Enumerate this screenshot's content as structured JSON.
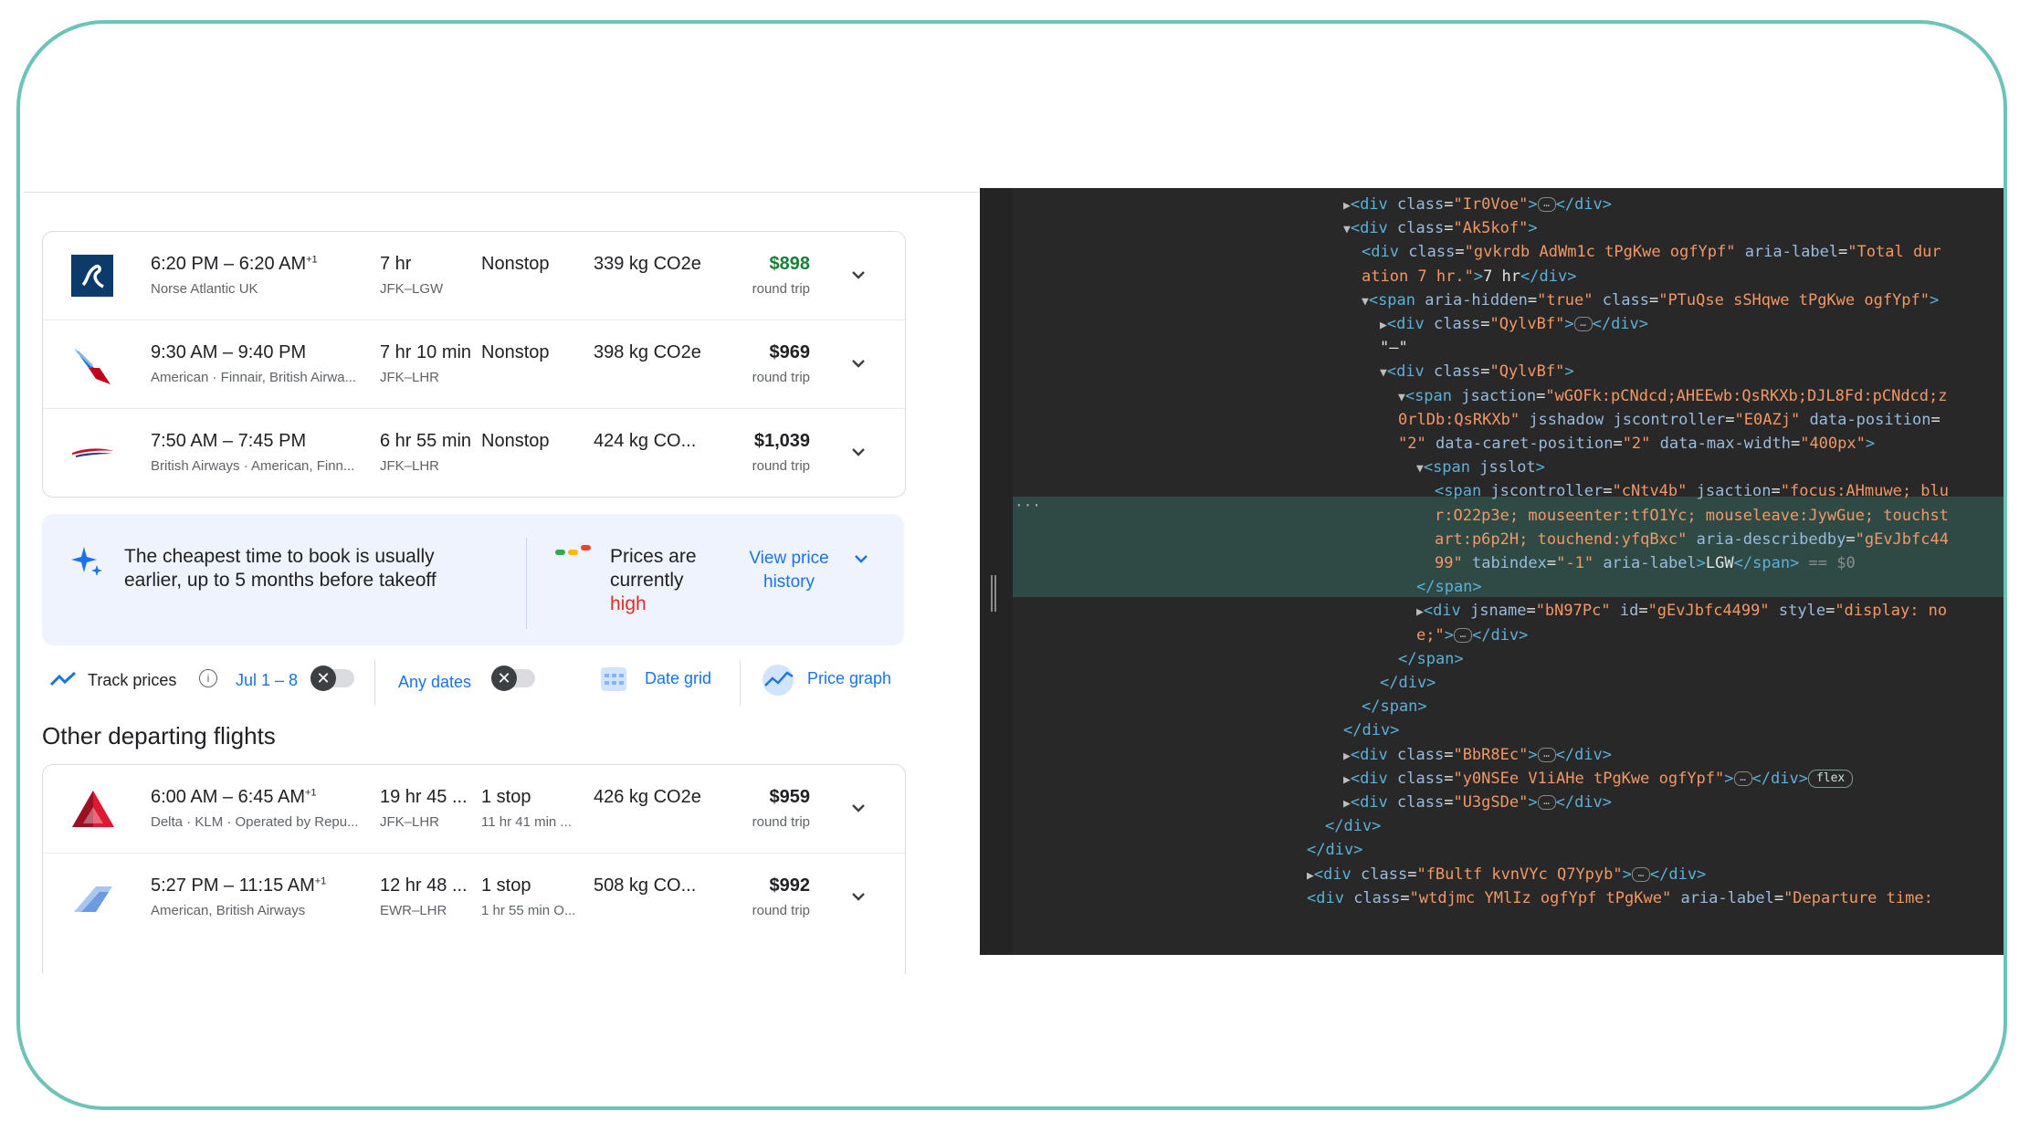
{
  "flights_top": [
    {
      "times": "6:20 PM – 6:20 AM",
      "plus": "+1",
      "airline": "Norse Atlantic UK",
      "duration": "7 hr",
      "route": "JFK–LGW",
      "stops": "Nonstop",
      "stops_sub": "",
      "co2": "339 kg CO2e",
      "price": "$898",
      "price_sub": "round trip",
      "price_color": "#188038",
      "logo": "norse-logo"
    },
    {
      "times": "9:30 AM – 9:40 PM",
      "plus": "",
      "airline": "American · Finnair, British Airwa...",
      "duration": "7 hr 10 min",
      "route": "JFK–LHR",
      "stops": "Nonstop",
      "stops_sub": "",
      "co2": "398 kg CO2e",
      "price": "$969",
      "price_sub": "round trip",
      "price_color": "#202124",
      "logo": "american-logo"
    },
    {
      "times": "7:50 AM – 7:45 PM",
      "plus": "",
      "airline": "British Airways · American, Finn...",
      "duration": "6 hr 55 min",
      "route": "JFK–LHR",
      "stops": "Nonstop",
      "stops_sub": "",
      "co2": "424 kg CO...",
      "price": "$1,039",
      "price_sub": "round trip",
      "price_color": "#202124",
      "logo": "british-airways-logo"
    }
  ],
  "tip": {
    "text": "The cheapest time to book is usually earlier, up to 5 months before takeoff",
    "prices_are": "Prices are currently",
    "state": "high",
    "view_history": "View price history"
  },
  "toolbar": {
    "track_prices": "Track prices",
    "date_range": "Jul 1 – 8",
    "any_dates": "Any dates",
    "date_grid": "Date grid",
    "price_graph": "Price graph",
    "toggle_mark": "✕"
  },
  "other_title": "Other departing flights",
  "flights_other": [
    {
      "times": "6:00 AM – 6:45 AM",
      "plus": "+1",
      "airline": "Delta · KLM · Operated by Repu...",
      "duration": "19 hr 45 ...",
      "route": "JFK–LHR",
      "stops": "1 stop",
      "stops_sub": "11 hr 41 min ...",
      "co2": "426 kg CO2e",
      "price": "$959",
      "price_sub": "round trip",
      "price_color": "#202124",
      "logo": "delta-logo"
    },
    {
      "times": "5:27 PM – 11:15 AM",
      "plus": "+1",
      "airline": "American, British Airways",
      "duration": "12 hr 48 ...",
      "route": "EWR–LHR",
      "stops": "1 stop",
      "stops_sub": "1 hr 55 min O...",
      "co2": "508 kg CO...",
      "price": "$992",
      "price_sub": "round trip",
      "price_color": "#202124",
      "logo": "multi-airline-logo"
    }
  ],
  "devtools": {
    "lines": [
      {
        "indent": 0,
        "arrow": "▶",
        "parts": [
          [
            "tg",
            "<div "
          ],
          [
            "an",
            "class"
          ],
          [
            "tx",
            "="
          ],
          [
            "av",
            "\"Ir0Voe\""
          ],
          [
            "tg",
            ">"
          ],
          [
            "ell",
            "…"
          ],
          [
            "tg",
            "</div>"
          ]
        ]
      },
      {
        "indent": 0,
        "arrow": "▼",
        "parts": [
          [
            "tg",
            "<div "
          ],
          [
            "an",
            "class"
          ],
          [
            "tx",
            "="
          ],
          [
            "av",
            "\"Ak5kof\""
          ],
          [
            "tg",
            ">"
          ]
        ]
      },
      {
        "indent": 1,
        "arrow": "",
        "parts": [
          [
            "tg",
            "<div "
          ],
          [
            "an",
            "class"
          ],
          [
            "tx",
            "="
          ],
          [
            "av",
            "\"gvkrdb AdWm1c tPgKwe ogfYpf\""
          ],
          [
            "tx",
            " "
          ],
          [
            "an",
            "aria-label"
          ],
          [
            "tx",
            "="
          ],
          [
            "av",
            "\"Total dur"
          ]
        ]
      },
      {
        "indent": 1,
        "arrow": "",
        "parts": [
          [
            "av",
            "ation 7 hr.\""
          ],
          [
            "tg",
            ">"
          ],
          [
            "tx",
            "7 hr"
          ],
          [
            "tg",
            "</div>"
          ]
        ]
      },
      {
        "indent": 1,
        "arrow": "▼",
        "parts": [
          [
            "tg",
            "<span "
          ],
          [
            "an",
            "aria-hidden"
          ],
          [
            "tx",
            "="
          ],
          [
            "av",
            "\"true\""
          ],
          [
            "tx",
            " "
          ],
          [
            "an",
            "class"
          ],
          [
            "tx",
            "="
          ],
          [
            "av",
            "\"PTuQse sSHqwe tPgKwe ogfYpf\""
          ],
          [
            "tg",
            ">"
          ]
        ]
      },
      {
        "indent": 2,
        "arrow": "▶",
        "parts": [
          [
            "tg",
            "<div "
          ],
          [
            "an",
            "class"
          ],
          [
            "tx",
            "="
          ],
          [
            "av",
            "\"QylvBf\""
          ],
          [
            "tg",
            ">"
          ],
          [
            "ell",
            "…"
          ],
          [
            "tg",
            "</div>"
          ]
        ]
      },
      {
        "indent": 2,
        "arrow": "",
        "parts": [
          [
            "tx",
            "\"–\""
          ]
        ]
      },
      {
        "indent": 2,
        "arrow": "▼",
        "parts": [
          [
            "tg",
            "<div "
          ],
          [
            "an",
            "class"
          ],
          [
            "tx",
            "="
          ],
          [
            "av",
            "\"QylvBf\""
          ],
          [
            "tg",
            ">"
          ]
        ]
      },
      {
        "indent": 3,
        "arrow": "▼",
        "parts": [
          [
            "tg",
            "<span "
          ],
          [
            "an",
            "jsaction"
          ],
          [
            "tx",
            "="
          ],
          [
            "av",
            "\"wGOFk:pCNdcd;AHEEwb:QsRKXb;DJL8Fd:pCNdcd;z"
          ]
        ]
      },
      {
        "indent": 3,
        "arrow": "",
        "parts": [
          [
            "av",
            "0rlDb:QsRKXb\""
          ],
          [
            "tx",
            " "
          ],
          [
            "an",
            "jsshadow"
          ],
          [
            "tx",
            " "
          ],
          [
            "an",
            "jscontroller"
          ],
          [
            "tx",
            "="
          ],
          [
            "av",
            "\"E0AZj\""
          ],
          [
            "tx",
            " "
          ],
          [
            "an",
            "data-position"
          ],
          [
            "tx",
            "="
          ]
        ]
      },
      {
        "indent": 3,
        "arrow": "",
        "parts": [
          [
            "av",
            "\"2\""
          ],
          [
            "tx",
            " "
          ],
          [
            "an",
            "data-caret-position"
          ],
          [
            "tx",
            "="
          ],
          [
            "av",
            "\"2\""
          ],
          [
            "tx",
            " "
          ],
          [
            "an",
            "data-max-width"
          ],
          [
            "tx",
            "="
          ],
          [
            "av",
            "\"400px\""
          ],
          [
            "tg",
            ">"
          ]
        ]
      },
      {
        "indent": 4,
        "arrow": "▼",
        "parts": [
          [
            "tg",
            "<span "
          ],
          [
            "an",
            "jsslot"
          ],
          [
            "tg",
            ">"
          ]
        ]
      },
      {
        "indent": 5,
        "arrow": "",
        "parts": [
          [
            "tg",
            "<span "
          ],
          [
            "an",
            "jscontroller"
          ],
          [
            "tx",
            "="
          ],
          [
            "av",
            "\"cNtv4b\""
          ],
          [
            "tx",
            " "
          ],
          [
            "an",
            "jsaction"
          ],
          [
            "tx",
            "="
          ],
          [
            "av",
            "\"focus:AHmuwe; blu"
          ]
        ]
      },
      {
        "indent": 5,
        "arrow": "",
        "parts": [
          [
            "av",
            "r:O22p3e; mouseenter:tfO1Yc; mouseleave:JywGue; touchst"
          ]
        ]
      },
      {
        "indent": 5,
        "arrow": "",
        "parts": [
          [
            "av",
            "art:p6p2H; touchend:yfqBxc\""
          ],
          [
            "tx",
            " "
          ],
          [
            "an",
            "aria-describedby"
          ],
          [
            "tx",
            "="
          ],
          [
            "av",
            "\"gEvJbfc44"
          ]
        ]
      },
      {
        "indent": 5,
        "arrow": "",
        "parts": [
          [
            "av",
            "99\""
          ],
          [
            "tx",
            " "
          ],
          [
            "an",
            "tabindex"
          ],
          [
            "tx",
            "="
          ],
          [
            "av",
            "\"-1\""
          ],
          [
            "tx",
            " "
          ],
          [
            "an",
            "aria-label"
          ],
          [
            "tg",
            ">"
          ],
          [
            "tx",
            "LGW"
          ],
          [
            "tg",
            "</span>"
          ],
          [
            "cm",
            " == $0"
          ]
        ]
      },
      {
        "indent": 4,
        "arrow": "",
        "parts": [
          [
            "tg",
            "</span>"
          ]
        ]
      },
      {
        "indent": 4,
        "arrow": "▶",
        "parts": [
          [
            "tg",
            "<div "
          ],
          [
            "an",
            "jsname"
          ],
          [
            "tx",
            "="
          ],
          [
            "av",
            "\"bN97Pc\""
          ],
          [
            "tx",
            " "
          ],
          [
            "an",
            "id"
          ],
          [
            "tx",
            "="
          ],
          [
            "av",
            "\"gEvJbfc4499\""
          ],
          [
            "tx",
            " "
          ],
          [
            "an",
            "style"
          ],
          [
            "tx",
            "="
          ],
          [
            "av",
            "\"display: no"
          ]
        ]
      },
      {
        "indent": 4,
        "arrow": "",
        "parts": [
          [
            "av",
            "e;\""
          ],
          [
            "tg",
            ">"
          ],
          [
            "ell",
            "…"
          ],
          [
            "tg",
            "</div>"
          ]
        ]
      },
      {
        "indent": 3,
        "arrow": "",
        "parts": [
          [
            "tg",
            "</span>"
          ]
        ]
      },
      {
        "indent": 2,
        "arrow": "",
        "parts": [
          [
            "tg",
            "</div>"
          ]
        ]
      },
      {
        "indent": 1,
        "arrow": "",
        "parts": [
          [
            "tg",
            "</span>"
          ]
        ]
      },
      {
        "indent": 0,
        "arrow": "",
        "parts": [
          [
            "tg",
            "</div>"
          ]
        ]
      },
      {
        "indent": 0,
        "arrow": "▶",
        "parts": [
          [
            "tg",
            "<div "
          ],
          [
            "an",
            "class"
          ],
          [
            "tx",
            "="
          ],
          [
            "av",
            "\"BbR8Ec\""
          ],
          [
            "tg",
            ">"
          ],
          [
            "ell",
            "…"
          ],
          [
            "tg",
            "</div>"
          ]
        ]
      },
      {
        "indent": 0,
        "arrow": "▶",
        "parts": [
          [
            "tg",
            "<div "
          ],
          [
            "an",
            "class"
          ],
          [
            "tx",
            "="
          ],
          [
            "av",
            "\"y0NSEe V1iAHe tPgKwe ogfYpf\""
          ],
          [
            "tg",
            ">"
          ],
          [
            "ell",
            "…"
          ],
          [
            "tg",
            "</div>"
          ],
          [
            "flex",
            "flex"
          ]
        ]
      },
      {
        "indent": 0,
        "arrow": "▶",
        "parts": [
          [
            "tg",
            "<div "
          ],
          [
            "an",
            "class"
          ],
          [
            "tx",
            "="
          ],
          [
            "av",
            "\"U3gSDe\""
          ],
          [
            "tg",
            ">"
          ],
          [
            "ell",
            "…"
          ],
          [
            "tg",
            "</div>"
          ]
        ]
      },
      {
        "indent": -1,
        "arrow": "",
        "parts": [
          [
            "tg",
            "</div>"
          ]
        ]
      },
      {
        "indent": -2,
        "arrow": "",
        "parts": [
          [
            "tg",
            "</div>"
          ]
        ]
      },
      {
        "indent": -2,
        "arrow": "▶",
        "parts": [
          [
            "tg",
            "<div "
          ],
          [
            "an",
            "class"
          ],
          [
            "tx",
            "="
          ],
          [
            "av",
            "\"fBultf kvnVYc Q7Ypyb\""
          ],
          [
            "tg",
            ">"
          ],
          [
            "ell",
            "…"
          ],
          [
            "tg",
            "</div>"
          ]
        ]
      },
      {
        "indent": -2,
        "arrow": "",
        "parts": [
          [
            "tg",
            "<div "
          ],
          [
            "an",
            "class"
          ],
          [
            "tx",
            "="
          ],
          [
            "av",
            "\"wtdjmc YMlIz ogfYpf tPgKwe\""
          ],
          [
            "tx",
            " "
          ],
          [
            "an",
            "aria-label"
          ],
          [
            "tx",
            "="
          ],
          [
            "av",
            "\"Departure time:"
          ]
        ]
      }
    ]
  }
}
